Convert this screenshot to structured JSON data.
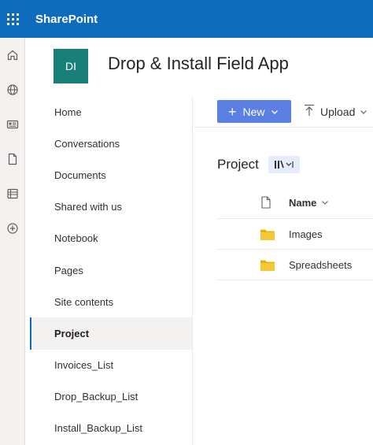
{
  "suite": {
    "app_name": "SharePoint"
  },
  "site": {
    "logo_initials": "DI",
    "title": "Drop & Install Field App",
    "logo_color": "#1b7f79"
  },
  "appbar": {
    "icons": [
      "home-icon",
      "globe-icon",
      "news-icon",
      "file-icon",
      "lists-icon",
      "create-icon"
    ]
  },
  "nav": {
    "items": [
      {
        "label": "Home",
        "selected": false
      },
      {
        "label": "Conversations",
        "selected": false
      },
      {
        "label": "Documents",
        "selected": false
      },
      {
        "label": "Shared with us",
        "selected": false
      },
      {
        "label": "Notebook",
        "selected": false
      },
      {
        "label": "Pages",
        "selected": false
      },
      {
        "label": "Site contents",
        "selected": false
      },
      {
        "label": "Project",
        "selected": true
      },
      {
        "label": "Invoices_List",
        "selected": false
      },
      {
        "label": "Drop_Backup_List",
        "selected": false
      },
      {
        "label": "Install_Backup_List",
        "selected": false
      }
    ]
  },
  "commandbar": {
    "new_label": "New",
    "upload_label": "Upload"
  },
  "library": {
    "title": "Project"
  },
  "list": {
    "name_header": "Name",
    "rows": [
      {
        "name": "Images",
        "type": "folder"
      },
      {
        "name": "Spreadsheets",
        "type": "folder"
      }
    ]
  },
  "colors": {
    "suitebar": "#0f6cbd",
    "new_button": "#5b7fe3",
    "folder": "#f2c811"
  }
}
